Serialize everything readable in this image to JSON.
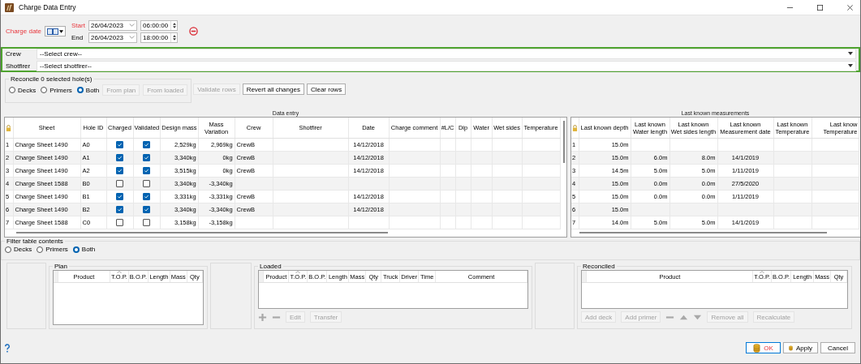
{
  "window": {
    "title": "Charge Data Entry"
  },
  "charge_date": {
    "label": "Charge date",
    "highlighted": true,
    "ranges": [
      {
        "label": "Start",
        "highlighted": true,
        "date": "26/04/2023",
        "time": "06:00:00"
      },
      {
        "label": "End",
        "highlighted": false,
        "date": "26/04/2023",
        "time": "18:00:00"
      }
    ]
  },
  "assignment": [
    {
      "label": "Crew",
      "value": "--Select crew--"
    },
    {
      "label": "Shotfirer",
      "value": "--Select shotfirer--"
    }
  ],
  "reconcile": {
    "legend": "Reconcile 0 selected hole(s)",
    "options": [
      {
        "label": "Decks",
        "selected": false
      },
      {
        "label": "Primers",
        "selected": false
      },
      {
        "label": "Both",
        "selected": true
      }
    ],
    "buttons": [
      {
        "label": "From plan",
        "disabled": true
      },
      {
        "label": "From loaded",
        "disabled": true
      }
    ]
  },
  "row_actions": [
    {
      "label": "Validate rows",
      "disabled": true
    },
    {
      "label": "Revert all changes",
      "disabled": false
    },
    {
      "label": "Clear rows",
      "disabled": false
    }
  ],
  "data_entry": {
    "caption": "Data entry",
    "columns": [
      "Sheet",
      "Hole ID",
      "Charged",
      "Validated",
      "Design mass",
      "Mass\nVariation",
      "Crew",
      "Shotfirer",
      "Date",
      "Charge comment",
      "#L/C",
      "Dip",
      "Water",
      "Wet sides",
      "Temperature"
    ],
    "rows": [
      {
        "number": "1",
        "sheet": "Charge Sheet 1490",
        "hole_id": "A0",
        "charged": true,
        "validated": true,
        "design_mass": "2,529kg",
        "mass_variation": "2,969kg",
        "crew": "CrewB",
        "date": "14/12/2018"
      },
      {
        "number": "2",
        "sheet": "Charge Sheet 1490",
        "hole_id": "A1",
        "charged": true,
        "validated": true,
        "design_mass": "3,340kg",
        "mass_variation": "0kg",
        "crew": "CrewB",
        "date": "14/12/2018"
      },
      {
        "number": "3",
        "sheet": "Charge Sheet 1490",
        "hole_id": "A2",
        "charged": true,
        "validated": true,
        "design_mass": "3,515kg",
        "mass_variation": "0kg",
        "crew": "CrewB",
        "date": "14/12/2018"
      },
      {
        "number": "4",
        "sheet": "Charge Sheet 1588",
        "hole_id": "B0",
        "charged": false,
        "validated": false,
        "design_mass": "3,340kg",
        "mass_variation": "-3,340kg"
      },
      {
        "number": "5",
        "sheet": "Charge Sheet 1490",
        "hole_id": "B1",
        "charged": true,
        "validated": true,
        "design_mass": "3,331kg",
        "mass_variation": "-3,331kg",
        "crew": "CrewB",
        "date": "14/12/2018"
      },
      {
        "number": "6",
        "sheet": "Charge Sheet 1490",
        "hole_id": "B2",
        "charged": true,
        "validated": true,
        "design_mass": "3,340kg",
        "mass_variation": "-3,340kg",
        "crew": "CrewB",
        "date": "14/12/2018"
      },
      {
        "number": "7",
        "sheet": "Charge Sheet 1588",
        "hole_id": "C0",
        "charged": false,
        "validated": false,
        "design_mass": "3,158kg",
        "mass_variation": "-3,158kg"
      }
    ]
  },
  "last_known": {
    "caption": "Last known measurements",
    "columns": [
      "Last known depth",
      "Last known\nWater length",
      "Last known\nWet sides length",
      "Last known\nMeasurement date",
      "Last known\nTemperature",
      "Last know\nTemperature"
    ],
    "rows": [
      {
        "number": "1",
        "depth": "15.0m"
      },
      {
        "number": "2",
        "depth": "15.0m",
        "water_length": "6.0m",
        "wet_sides_length": "8.0m",
        "measurement_date": "14/1/2019"
      },
      {
        "number": "3",
        "depth": "14.5m",
        "water_length": "5.0m",
        "wet_sides_length": "5.0m",
        "measurement_date": "1/11/2019"
      },
      {
        "number": "4",
        "depth": "15.0m",
        "water_length": "0.0m",
        "wet_sides_length": "0.0m",
        "measurement_date": "27/5/2020"
      },
      {
        "number": "5",
        "depth": "15.0m",
        "water_length": "0.0m",
        "wet_sides_length": "0.0m",
        "measurement_date": "1/11/2019"
      },
      {
        "number": "6",
        "depth": "15.0m"
      },
      {
        "number": "7",
        "depth": "14.0m",
        "water_length": "5.0m",
        "wet_sides_length": "5.0m",
        "measurement_date": "14/1/2019"
      }
    ]
  },
  "filter": {
    "legend": "Filter table contents",
    "options": [
      {
        "label": "Decks",
        "selected": false
      },
      {
        "label": "Primers",
        "selected": false
      },
      {
        "label": "Both",
        "selected": true
      }
    ]
  },
  "plan": {
    "title": "Plan",
    "columns": [
      {
        "label": "Product",
        "sorted": false
      },
      {
        "label": "T.O.P.",
        "sorted": true
      },
      {
        "label": "B.O.P.",
        "sorted": false
      },
      {
        "label": "Length",
        "sorted": false
      },
      {
        "label": "Mass",
        "sorted": false
      },
      {
        "label": "Qty",
        "sorted": false
      }
    ]
  },
  "loaded": {
    "title": "Loaded",
    "columns": [
      {
        "label": "Product",
        "sorted": false
      },
      {
        "label": "T.O.P.",
        "sorted": true
      },
      {
        "label": "B.O.P.",
        "sorted": false
      },
      {
        "label": "Length",
        "sorted": false
      },
      {
        "label": "Mass",
        "sorted": false
      },
      {
        "label": "Qty",
        "sorted": false
      },
      {
        "label": "Truck",
        "sorted": false
      },
      {
        "label": "Driver",
        "sorted": false
      },
      {
        "label": "Time",
        "sorted": false
      },
      {
        "label": "Comment",
        "sorted": false
      }
    ],
    "tools": [
      {
        "kind": "plus",
        "disabled": true
      },
      {
        "kind": "minus",
        "disabled": true
      },
      {
        "kind": "button",
        "label": "Edit",
        "disabled": true
      },
      {
        "kind": "button",
        "label": "Transfer",
        "disabled": true
      }
    ]
  },
  "reconciled": {
    "title": "Reconciled",
    "columns": [
      {
        "label": "Product",
        "sorted": false
      },
      {
        "label": "T.O.P.",
        "sorted": true
      },
      {
        "label": "B.O.P.",
        "sorted": false
      },
      {
        "label": "Length",
        "sorted": false
      },
      {
        "label": "Mass",
        "sorted": false
      },
      {
        "label": "Qty",
        "sorted": false
      }
    ],
    "tools": [
      {
        "kind": "button",
        "label": "Add deck",
        "disabled": true
      },
      {
        "kind": "button",
        "label": "Add primer",
        "disabled": true
      },
      {
        "kind": "minus",
        "disabled": true
      },
      {
        "kind": "up",
        "disabled": true
      },
      {
        "kind": "down",
        "disabled": true
      },
      {
        "kind": "button",
        "label": "Remove all",
        "disabled": true
      },
      {
        "kind": "button",
        "label": "Recalculate",
        "disabled": true
      }
    ]
  },
  "footer": {
    "buttons": [
      {
        "label": "OK",
        "default": true,
        "kind": "with-icon"
      },
      {
        "label": "Apply",
        "default": false,
        "kind": "with-icon"
      },
      {
        "label": "Cancel",
        "default": false,
        "kind": "plain"
      }
    ]
  }
}
